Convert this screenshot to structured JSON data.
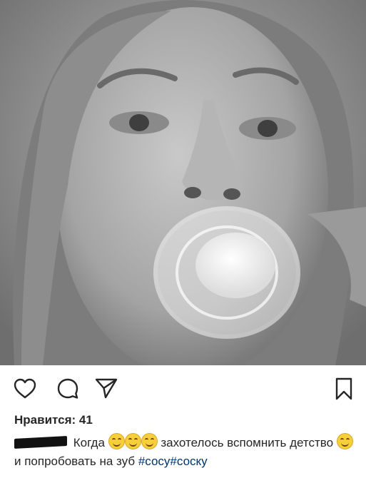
{
  "post": {
    "likes_text": "Нравится: 41",
    "caption_part1": "Когда",
    "caption_part2": "захотелось вспомнить детство",
    "caption_part3": "и попробовать на зуб",
    "hashtags": [
      "#сосу",
      "#соску"
    ]
  },
  "icons": {
    "like": "heart-icon",
    "comment": "comment-icon",
    "share": "send-icon",
    "save": "bookmark-icon"
  },
  "colors": {
    "text": "#262626",
    "hashtag": "#003569"
  }
}
